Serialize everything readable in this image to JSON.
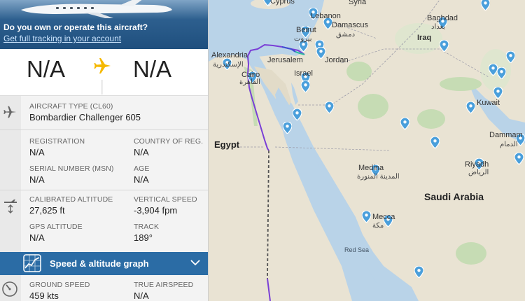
{
  "promo": {
    "question": "Do you own or operate this aircraft?",
    "link": "Get full tracking in your account"
  },
  "route": {
    "origin": "N/A",
    "destination": "N/A"
  },
  "aircraft": {
    "type_label": "AIRCRAFT TYPE",
    "type_code": "(CL60)",
    "type_value": "Bombardier Challenger 605",
    "registration_label": "REGISTRATION",
    "registration_value": "N/A",
    "country_label": "COUNTRY OF REG.",
    "country_value": "N/A",
    "serial_label": "SERIAL NUMBER (MSN)",
    "serial_value": "N/A",
    "age_label": "AGE",
    "age_value": "N/A"
  },
  "altitude": {
    "calibrated_label": "CALIBRATED ALTITUDE",
    "calibrated_value": "27,625 ft",
    "vspeed_label": "VERTICAL SPEED",
    "vspeed_value": "-3,904 fpm",
    "gps_label": "GPS ALTITUDE",
    "gps_value": "N/A",
    "track_label": "TRACK",
    "track_value": "189°"
  },
  "graph": {
    "label": "Speed & altitude graph"
  },
  "speed": {
    "ground_label": "GROUND SPEED",
    "ground_value": "459 kts",
    "tas_label": "TRUE AIRSPEED",
    "tas_value": "N/A"
  },
  "map": {
    "labels": {
      "cyprus": "Cyprus",
      "syria": "Syria",
      "lebanon": "Lebanon",
      "beirut": "Beirut",
      "beirut_ar": "بيروت",
      "damascus": "Damascus",
      "damascus_ar": "دمشق",
      "baghdad": "Baghdad",
      "baghdad_ar": "بغداد",
      "iraq": "Iraq",
      "alexandria": "Alexandria",
      "alexandria_ar": "الإسكندرية",
      "jerusalem": "Jerusalem",
      "jordan": "Jordan",
      "cairo": "Cairo",
      "cairo_ar": "القاهرة",
      "israel": "Israel",
      "kuwait": "Kuwait",
      "egypt": "Egypt",
      "dammam": "Dammam",
      "dammam_ar": "الدمام",
      "medina": "Medina",
      "medina_ar": "المدينة المنورة",
      "riyadh": "Riyadh",
      "riyadh_ar": "الرياض",
      "saudi": "Saudi Arabia",
      "mecca": "Mecca",
      "mecca_ar": "مكة",
      "red_sea": "Red Sea"
    },
    "colors": {
      "water": "#b9d3e8",
      "land": "#e8e2d4",
      "green": "#c6dcb4",
      "track_purple": "#7a3fd6",
      "track_blue": "#3d4fd0",
      "pin": "#4a9fdb"
    }
  }
}
